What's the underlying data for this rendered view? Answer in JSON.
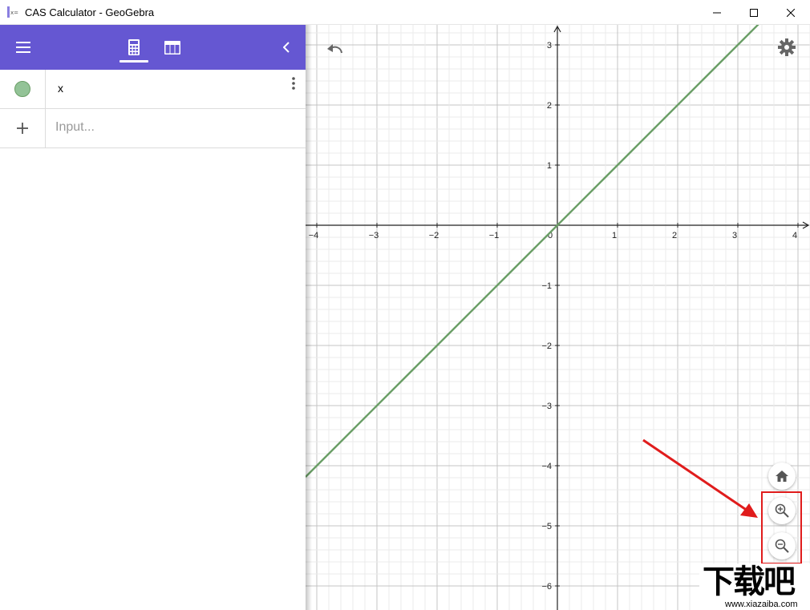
{
  "window": {
    "title": "CAS Calculator - GeoGebra"
  },
  "algebra": {
    "items": [
      {
        "expression": "x",
        "color": "#93c397"
      }
    ],
    "input_placeholder": "Input..."
  },
  "graphics": {
    "x_ticks": [
      "−4",
      "−3",
      "−2",
      "−1",
      "0",
      "1",
      "2",
      "3",
      "4"
    ],
    "y_ticks": [
      "3",
      "2",
      "1",
      "−1",
      "−2",
      "−3",
      "−4",
      "−5",
      "−6"
    ],
    "line_color": "#6a9e66",
    "xlim": [
      -4.2,
      4.2
    ],
    "ylim": [
      -6.4,
      3.3
    ]
  },
  "icons": {
    "menu": "hamburger-menu-icon",
    "calculator": "calculator-icon",
    "table": "table-icon",
    "collapse": "chevron-left-icon",
    "undo": "undo-icon",
    "settings": "gear-icon",
    "home": "home-icon",
    "zoom_in": "zoom-in-icon",
    "zoom_out": "zoom-out-icon",
    "keyboard": "keyboard-icon"
  },
  "accent_color": "#6557d2",
  "annotation_color": "#e01c1c",
  "watermark": {
    "main": "下载吧",
    "sub": "www.xiazaiba.com"
  }
}
